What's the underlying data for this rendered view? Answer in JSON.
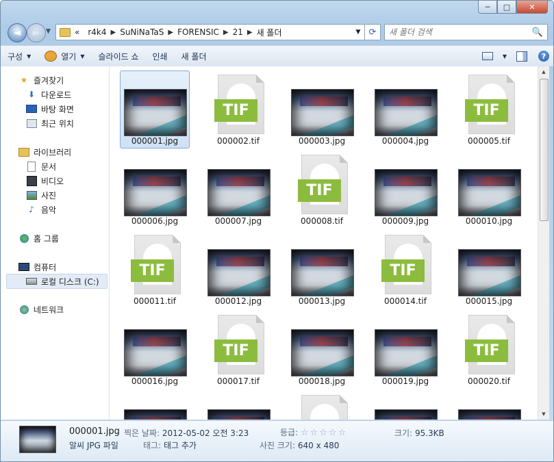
{
  "window": {
    "minimize": "─",
    "maximize": "□",
    "close": "✕"
  },
  "address": {
    "overflow": "«",
    "crumbs": [
      "r4k4",
      "SuNiNaTaS",
      "FORENSIC",
      "21",
      "새 폴더"
    ],
    "separator": "▶",
    "dropdown": "▼",
    "refresh": "⟳"
  },
  "search": {
    "placeholder": "새 폴더 검색",
    "icon": "🔍"
  },
  "nav": {
    "back": "◄",
    "forward": "►",
    "history": "▼"
  },
  "toolbar": {
    "organize": "구성",
    "open": "열기",
    "slideshow": "슬라이드 쇼",
    "print": "인쇄",
    "new_folder": "새 폴더",
    "arrow": "▼",
    "help": "?"
  },
  "sidebar": {
    "favorites": {
      "label": "즐겨찾기",
      "icon": "star-icon"
    },
    "favorites_items": [
      {
        "label": "다운로드",
        "icon": "downloads-icon"
      },
      {
        "label": "바탕 화면",
        "icon": "desktop-icon"
      },
      {
        "label": "최근 위치",
        "icon": "recent-places-icon"
      }
    ],
    "libraries": {
      "label": "라이브러리",
      "icon": "library-icon"
    },
    "libraries_items": [
      {
        "label": "문서",
        "icon": "documents-icon"
      },
      {
        "label": "비디오",
        "icon": "video-icon"
      },
      {
        "label": "사진",
        "icon": "pictures-icon"
      },
      {
        "label": "음악",
        "icon": "music-icon"
      }
    ],
    "homegroup": {
      "label": "홈 그룹",
      "icon": "homegroup-icon"
    },
    "computer": {
      "label": "컴퓨터",
      "icon": "computer-icon"
    },
    "local_disk": {
      "label": "로컬 디스크 (C:)",
      "icon": "drive-icon"
    },
    "network": {
      "label": "네트워크",
      "icon": "network-icon"
    }
  },
  "files": [
    {
      "name": "000001.jpg",
      "type": "jpg",
      "selected": true
    },
    {
      "name": "000002.tif",
      "type": "tif"
    },
    {
      "name": "000003.jpg",
      "type": "jpg"
    },
    {
      "name": "000004.jpg",
      "type": "jpg"
    },
    {
      "name": "000005.tif",
      "type": "tif"
    },
    {
      "name": "000006.jpg",
      "type": "jpg"
    },
    {
      "name": "000007.jpg",
      "type": "jpg"
    },
    {
      "name": "000008.tif",
      "type": "tif"
    },
    {
      "name": "000009.jpg",
      "type": "jpg"
    },
    {
      "name": "000010.jpg",
      "type": "jpg"
    },
    {
      "name": "000011.tif",
      "type": "tif"
    },
    {
      "name": "000012.jpg",
      "type": "jpg"
    },
    {
      "name": "000013.jpg",
      "type": "jpg"
    },
    {
      "name": "000014.tif",
      "type": "tif"
    },
    {
      "name": "000015.jpg",
      "type": "jpg"
    },
    {
      "name": "000016.jpg",
      "type": "jpg"
    },
    {
      "name": "000017.tif",
      "type": "tif"
    },
    {
      "name": "000018.jpg",
      "type": "jpg"
    },
    {
      "name": "000019.jpg",
      "type": "jpg"
    },
    {
      "name": "000020.tif",
      "type": "tif"
    },
    {
      "name": "",
      "type": "jpg"
    },
    {
      "name": "",
      "type": "jpg"
    },
    {
      "name": "",
      "type": "tif"
    },
    {
      "name": "",
      "type": "jpg"
    },
    {
      "name": "",
      "type": "jpg"
    }
  ],
  "tif_badge": "TIF",
  "details": {
    "filename": "000001.jpg",
    "filetype": "알씨 JPG 파일",
    "date_taken_label": "찍은 날짜:",
    "date_taken": "2012-05-02 오전 3:23",
    "tags_label": "태그:",
    "tags_value": "태그 추가",
    "rating_label": "등급:",
    "rating_stars": "☆☆☆☆☆",
    "dimensions_label": "사진 크기:",
    "dimensions": "640 x 480",
    "size_label": "크기:",
    "size": "95.3KB"
  },
  "scrollbar": {
    "up": "▲",
    "down": "▼"
  }
}
